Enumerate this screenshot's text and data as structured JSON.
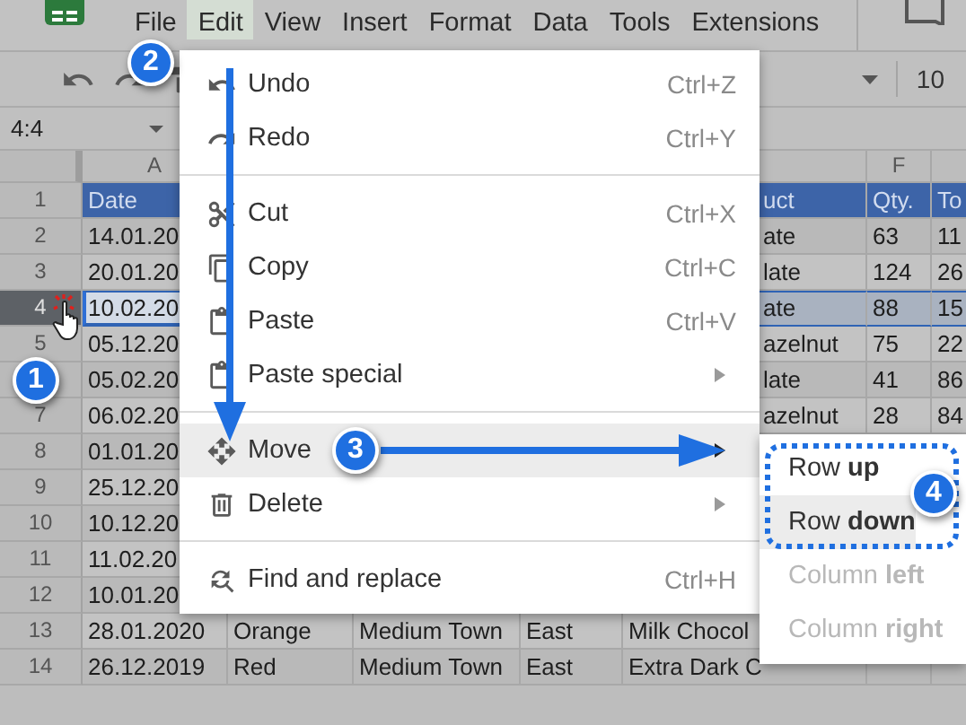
{
  "menubar": [
    {
      "label": "File",
      "selected": false
    },
    {
      "label": "Edit",
      "selected": true
    },
    {
      "label": "View",
      "selected": false
    },
    {
      "label": "Insert",
      "selected": false
    },
    {
      "label": "Format",
      "selected": false
    },
    {
      "label": "Data",
      "selected": false
    },
    {
      "label": "Tools",
      "selected": false
    },
    {
      "label": "Extensions",
      "selected": false
    }
  ],
  "toolbar": {
    "font_size": "10"
  },
  "name_box": "4:4",
  "sheet": {
    "column_headers": {
      "column_a": "A",
      "column_f": "F"
    },
    "rows": [
      {
        "number": "1",
        "kind": "header",
        "selected": false,
        "partly_hidden": true,
        "column_a": "Date",
        "column_e": "uct",
        "column_f": "Qty.",
        "column_g": "To"
      },
      {
        "number": "2",
        "kind": "data",
        "selected": false,
        "partly_hidden": true,
        "column_a": "14.01.20",
        "column_e": "ate",
        "column_f": "63",
        "column_g": "11"
      },
      {
        "number": "3",
        "kind": "data",
        "selected": false,
        "partly_hidden": true,
        "column_a": "20.01.20",
        "column_e": "late",
        "column_f": "124",
        "column_g": "26"
      },
      {
        "number": "4",
        "kind": "data",
        "selected": true,
        "partly_hidden": true,
        "column_a": "10.02.20",
        "column_e": "ate",
        "column_f": "88",
        "column_g": "15"
      },
      {
        "number": "5",
        "kind": "data",
        "selected": false,
        "partly_hidden": true,
        "column_a": "05.12.20",
        "column_e": "azelnut",
        "column_f": "75",
        "column_g": "22"
      },
      {
        "kind": "data",
        "selected": false,
        "partly_hidden": true,
        "column_a": "05.02.20",
        "column_e": "late",
        "column_f": "41",
        "column_g": "86"
      },
      {
        "number": "7",
        "kind": "data",
        "selected": false,
        "partly_hidden": true,
        "column_a": "06.02.20",
        "column_e": "azelnut",
        "column_f": "28",
        "column_g": "84"
      },
      {
        "number": "8",
        "kind": "data",
        "selected": false,
        "column_a": "01.01.20"
      },
      {
        "number": "9",
        "kind": "data",
        "selected": false,
        "column_a": "25.12.20"
      },
      {
        "number": "10",
        "kind": "data",
        "selected": false,
        "column_a": "10.12.20"
      },
      {
        "number": "11",
        "kind": "data",
        "selected": false,
        "column_a": "11.02.20"
      },
      {
        "number": "12",
        "kind": "data",
        "selected": false,
        "column_a": "10.01.20"
      },
      {
        "number": "13",
        "kind": "data",
        "selected": false,
        "partly_hidden": false,
        "column_a": "28.01.2020",
        "column_b": "Orange",
        "column_c": "Medium Town",
        "column_d": "East",
        "column_e": "Milk Chocol"
      },
      {
        "number": "14",
        "kind": "data",
        "selected": false,
        "partly_hidden": false,
        "column_a": "26.12.2019",
        "column_b": "Red",
        "column_c": "Medium Town",
        "column_d": "East",
        "column_e": "Extra Dark C"
      }
    ]
  },
  "edit_menu": {
    "groups": [
      {
        "items": [
          {
            "label": "Undo",
            "shortcut": "Ctrl+Z",
            "submenu": false,
            "highlighted": false
          },
          {
            "label": "Redo",
            "shortcut": "Ctrl+Y",
            "submenu": false,
            "highlighted": false
          }
        ]
      },
      {
        "items": [
          {
            "label": "Cut",
            "shortcut": "Ctrl+X",
            "submenu": false,
            "highlighted": false
          },
          {
            "label": "Copy",
            "shortcut": "Ctrl+C",
            "submenu": false,
            "highlighted": false
          },
          {
            "label": "Paste",
            "shortcut": "Ctrl+V",
            "submenu": false,
            "highlighted": false
          },
          {
            "label": "Paste special",
            "submenu": true,
            "highlighted": false
          }
        ]
      },
      {
        "items": [
          {
            "label": "Move",
            "submenu": true,
            "highlighted": true
          },
          {
            "label": "Delete",
            "submenu": true,
            "highlighted": false
          }
        ]
      },
      {
        "items": [
          {
            "label": "Find and replace",
            "shortcut": "Ctrl+H",
            "submenu": false,
            "highlighted": false
          }
        ]
      }
    ]
  },
  "move_submenu": {
    "items": [
      {
        "label": "Row **up**",
        "highlighted": false,
        "disabled": false
      },
      {
        "label": "Row **down**",
        "highlighted": true,
        "disabled": false
      },
      {
        "label": "Column **left**",
        "highlighted": false,
        "disabled": true
      },
      {
        "label": "Column **right**",
        "highlighted": false,
        "disabled": true
      }
    ]
  },
  "callouts": [
    {
      "label": "1"
    },
    {
      "label": "2"
    },
    {
      "label": "3"
    },
    {
      "label": "4"
    }
  ]
}
